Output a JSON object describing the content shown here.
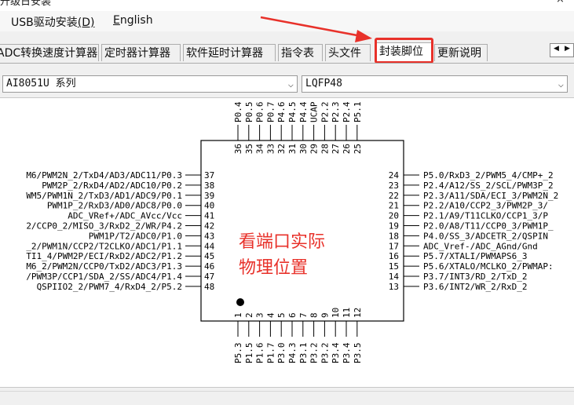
{
  "window": {
    "title_partial": "升级日安装",
    "minimize_glyph": "─",
    "close_glyph": "×"
  },
  "menu": {
    "items": [
      {
        "label": "USB驱动安装",
        "mnemonic": "(D)"
      },
      {
        "label": "",
        "mnemonic": "E",
        "rest": "nglish"
      }
    ]
  },
  "tabs": [
    {
      "label": "ADC转换速度计算器"
    },
    {
      "label": "定时器计算器"
    },
    {
      "label": "软件延时计算器"
    },
    {
      "label": "指令表"
    },
    {
      "label": "头文件"
    },
    {
      "label": "封装脚位",
      "active": true
    },
    {
      "label": "更新说明"
    }
  ],
  "tab_scroll": {
    "left_icon": "◀",
    "right_icon": "▶"
  },
  "series_select": {
    "value": "AI8051U 系列",
    "icon": "chevron-down-icon"
  },
  "package_select": {
    "value": "LQFP48",
    "icon": "chevron-down-icon"
  },
  "annotation": {
    "text_line1": "看端口实际",
    "text_line2": "物理位置",
    "color": "#e8312a"
  },
  "chip": {
    "top_numbers": [
      "36",
      "35",
      "34",
      "33",
      "32",
      "31",
      "30",
      "29",
      "28",
      "27",
      "26",
      "25"
    ],
    "top_labels": [
      "P0.4",
      "P0.5",
      "P0.6",
      "P0.7",
      "P4.6",
      "P4.5",
      "P4.4",
      "UCAP",
      "P2.2",
      "P2.3",
      "P2.4",
      "P5.1"
    ],
    "bottom_numbers": [
      "1",
      "2",
      "3",
      "4",
      "5",
      "6",
      "7",
      "8",
      "9",
      "10",
      "11",
      "12"
    ],
    "bottom_labels": [
      "P5.3",
      "P1.5",
      "P1.6",
      "P1.7",
      "P3.0",
      "P4.3",
      "P3.1",
      "P3.2",
      "P3.2",
      "P3.4",
      "P3.4",
      "P3.5"
    ],
    "left_pins": [
      {
        "num": "37",
        "label": "M6/PWM2N_2/TxD4/AD3/ADC11/P0.3"
      },
      {
        "num": "38",
        "label": "PWM2P_2/RxD4/AD2/ADC10/P0.2"
      },
      {
        "num": "39",
        "label": "WM5/PWM1N_2/TxD3/AD1/ADC9/P0.1"
      },
      {
        "num": "40",
        "label": "PWM1P_2/RxD3/AD0/ADC8/P0.0"
      },
      {
        "num": "41",
        "label": "ADC_VRef+/ADC_AVcc/Vcc"
      },
      {
        "num": "42",
        "label": "2/CCP0_2/MISO_3/RxD2_2/WR/P4.2"
      },
      {
        "num": "43",
        "label": "PWM1P/T2/ADC0/P1.0"
      },
      {
        "num": "44",
        "label": "_2/PWM1N/CCP2/T2CLKO/ADC1/P1.1"
      },
      {
        "num": "45",
        "label": "TI1_4/PWM2P/ECI/RxD2/ADC2/P1.2"
      },
      {
        "num": "46",
        "label": "M6_2/PWM2N/CCP0/TxD2/ADC3/P1.3"
      },
      {
        "num": "47",
        "label": "/PWM3P/CCP1/SDA_2/SS/ADC4/P1.4"
      },
      {
        "num": "48",
        "label": "QSPIIO2_2/PWM7_4/RxD4_2/P5.2"
      }
    ],
    "right_pins": [
      {
        "num": "24",
        "label": "P5.0/RxD3_2/PWM5_4/CMP+_2"
      },
      {
        "num": "23",
        "label": "P2.4/A12/SS_2/SCL/PWM3P_2"
      },
      {
        "num": "22",
        "label": "P2.3/A11/SDA/ECI_3/PWM2N_2"
      },
      {
        "num": "21",
        "label": "P2.2/A10/CCP2_3/PWM2P_3/"
      },
      {
        "num": "20",
        "label": "P2.1/A9/T11CLKO/CCP1_3/P"
      },
      {
        "num": "19",
        "label": "P2.0/A8/T11/CCP0_3/PWM1P_"
      },
      {
        "num": "18",
        "label": "P4.0/SS_3/ADCETR_2/QSPIN"
      },
      {
        "num": "17",
        "label": "ADC_Vref-/ADC_AGnd/Gnd"
      },
      {
        "num": "16",
        "label": "P5.7/XTALI/PWMAPS6_3"
      },
      {
        "num": "15",
        "label": "P5.6/XTALO/MCLKO_2/PWMAP:"
      },
      {
        "num": "14",
        "label": "P3.7/INT3/RD_2/TxD_2"
      },
      {
        "num": "13",
        "label": "P3.6/INT2/WR_2/RxD_2"
      }
    ]
  },
  "colors": {
    "accent_red": "#e8312a",
    "panel_bg": "#f0f0f0"
  }
}
